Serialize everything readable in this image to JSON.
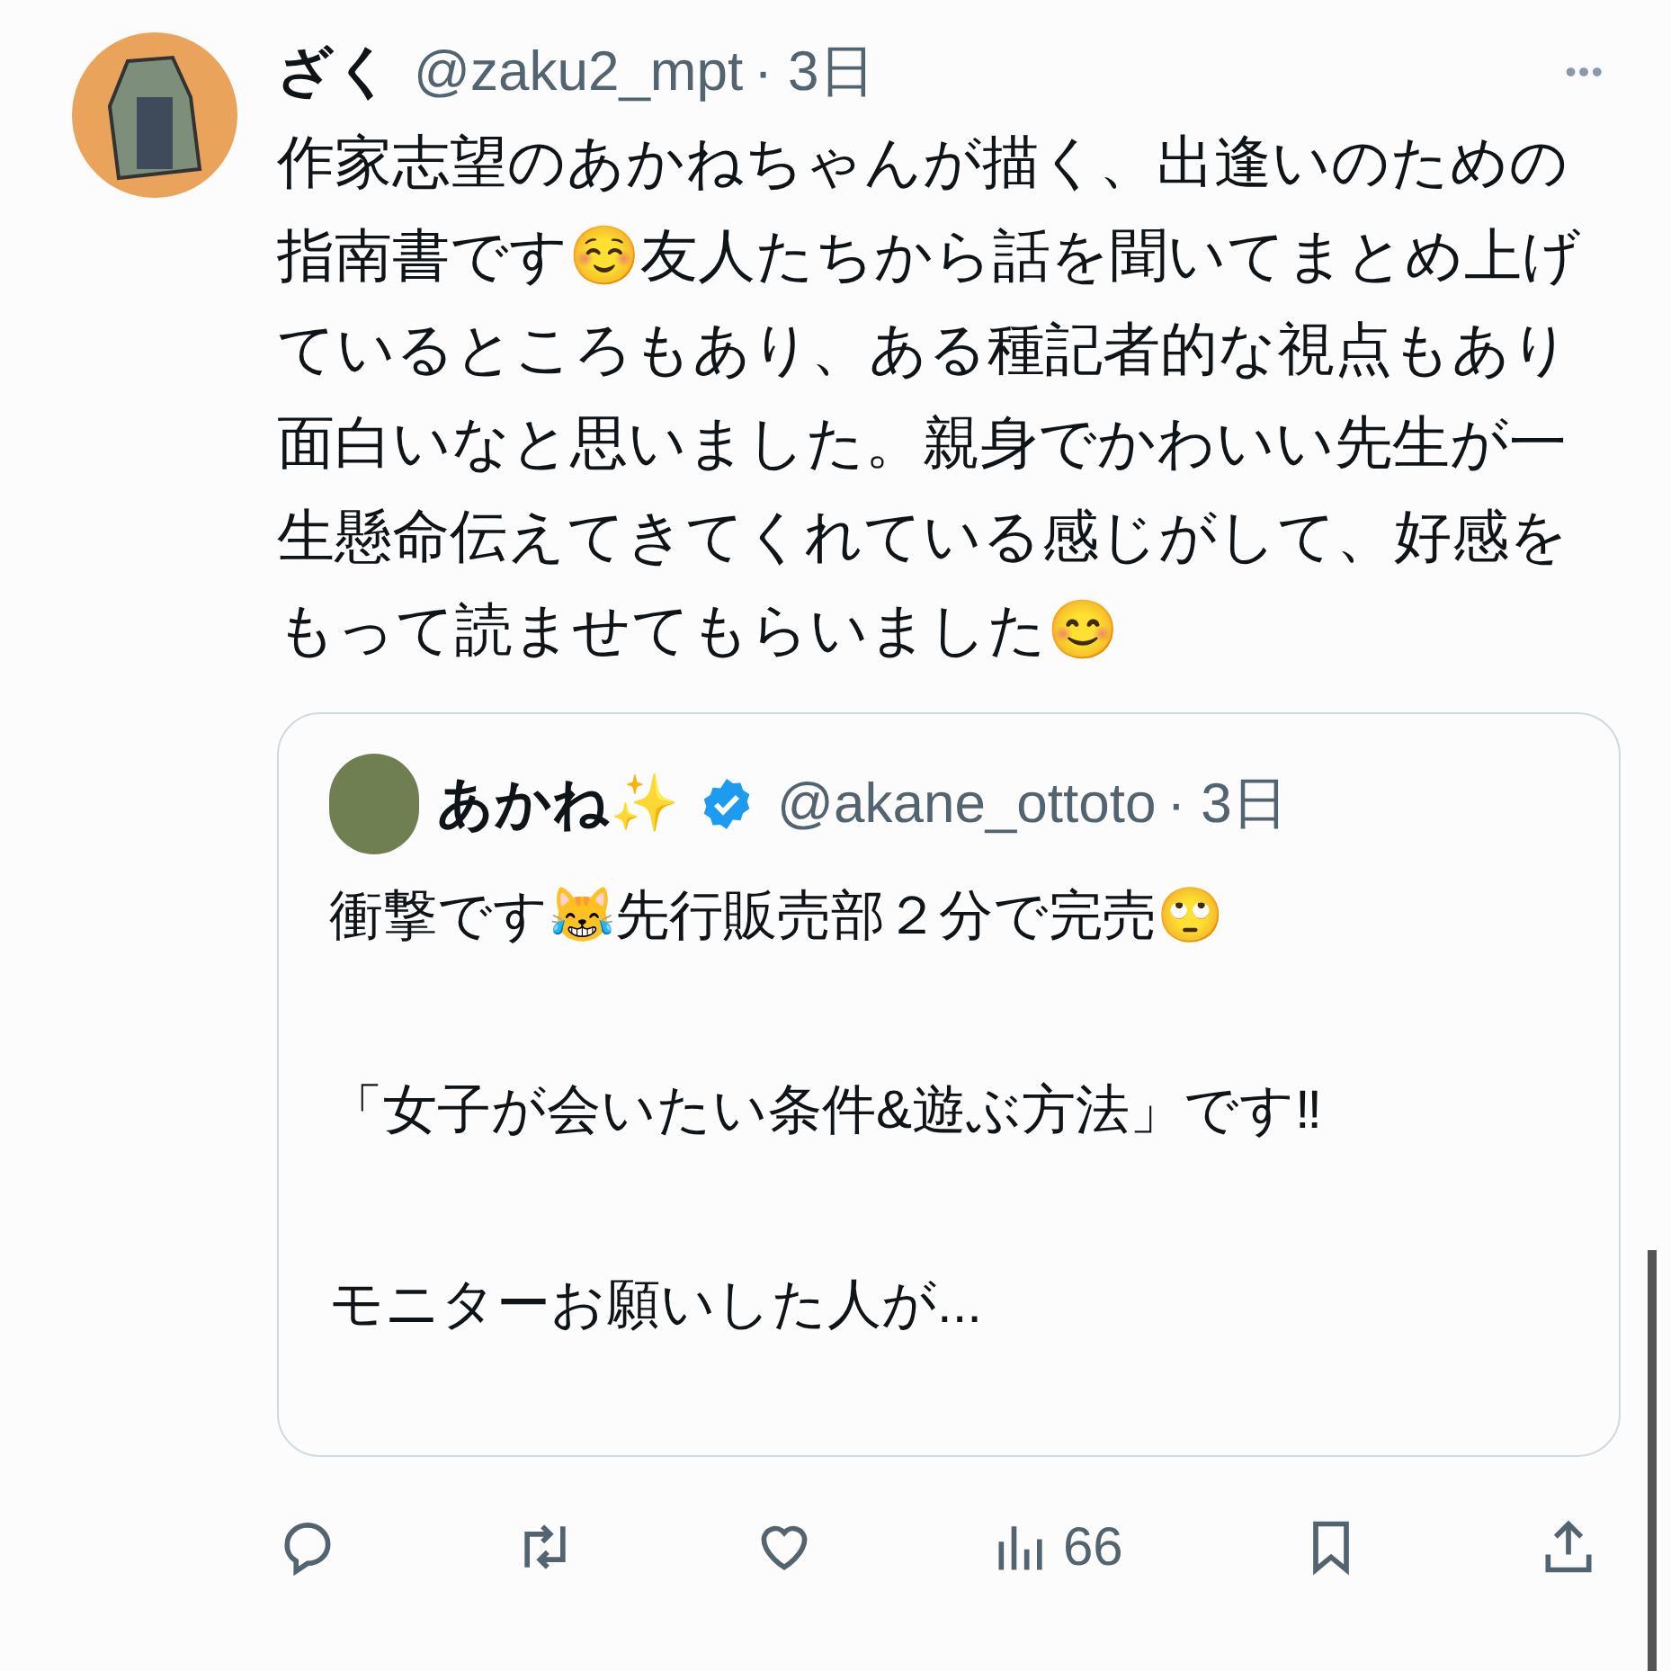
{
  "tweet": {
    "author": {
      "name": "ざく",
      "handle": "@zaku2_mpt",
      "time": "· 3日"
    },
    "more": "•••",
    "text": "作家志望のあかねちゃんが描く、出逢いのための指南書です☺️友人たちから話を聞いてまとめ上げているところもあり、ある種記者的な視点もあり面白いなと思いました。親身でかわいい先生が一生懸命伝えてきてくれている感じがして、好感をもって読ませてもらいました😊",
    "quote": {
      "author": {
        "name": "あかね✨",
        "verified": true,
        "handle": "@akane_ottoto",
        "time": "· 3日"
      },
      "text": "衝撃です😹先行販売部２分で完売🙄\n\n「女子が会いたい条件&遊ぶ方法」です‼\n\nモニターお願いした人が..."
    },
    "actions": [
      {
        "kind": "reply"
      },
      {
        "kind": "retweet"
      },
      {
        "kind": "like"
      },
      {
        "kind": "views",
        "count": "66"
      },
      {
        "kind": "bookmark"
      },
      {
        "kind": "share"
      }
    ]
  }
}
